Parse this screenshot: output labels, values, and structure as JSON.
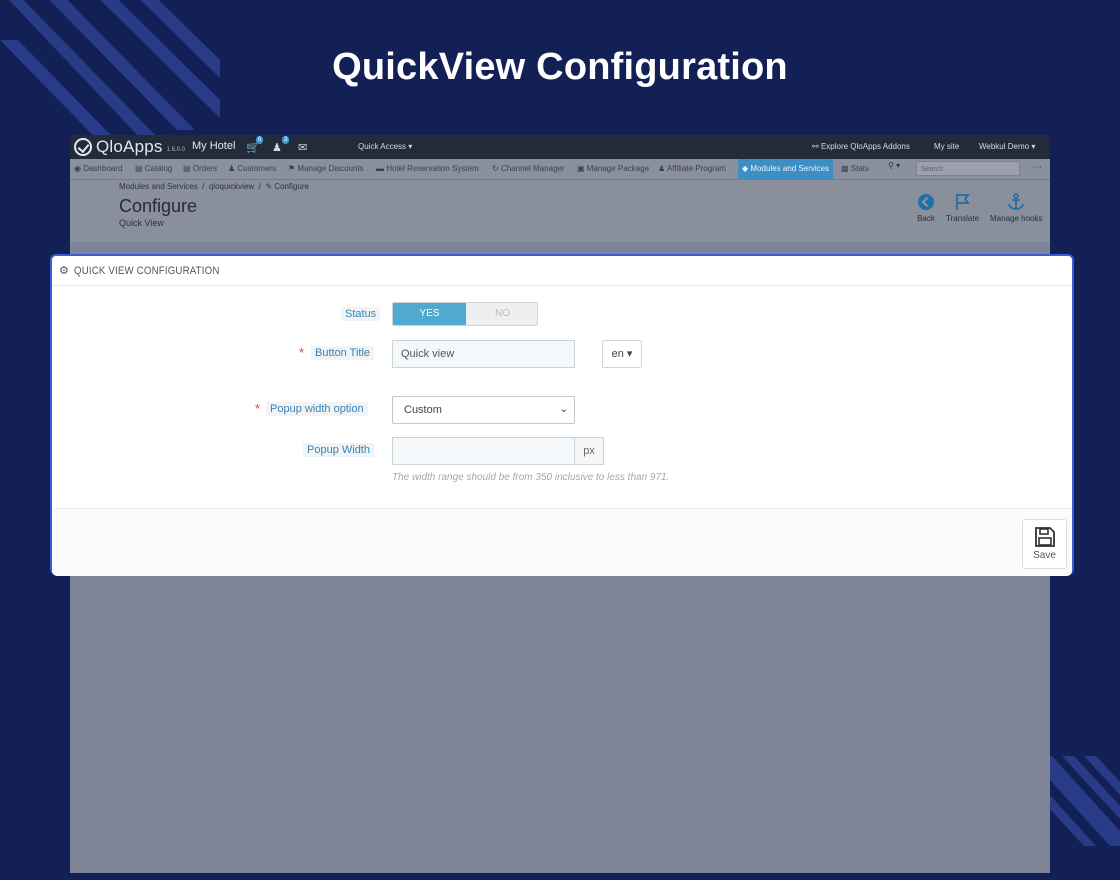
{
  "banner": {
    "title": "QuickView Configuration"
  },
  "topbar": {
    "brand": "QloApps",
    "version": "1.6.0.0",
    "hotel": "My Hotel",
    "cart_badge": "0",
    "customer_badge": "3",
    "quick_access": "Quick Access",
    "explore_addons": "Explore QloApps Addons",
    "my_site": "My site",
    "user": "Webkul Demo"
  },
  "nav": {
    "items": [
      {
        "label": "Dashboard",
        "icon": "dashboard-icon"
      },
      {
        "label": "Catalog",
        "icon": "book-icon"
      },
      {
        "label": "Orders",
        "icon": "credit-card-icon"
      },
      {
        "label": "Customers",
        "icon": "users-icon"
      },
      {
        "label": "Manage Discounts",
        "icon": "tag-icon"
      },
      {
        "label": "Hotel Reservation System",
        "icon": "bed-icon"
      },
      {
        "label": "Channel Manager",
        "icon": "refresh-icon"
      },
      {
        "label": "Manage Package",
        "icon": "briefcase-icon"
      },
      {
        "label": "Affiliate Program",
        "icon": "users-icon"
      },
      {
        "label": "Modules and Services",
        "icon": "puzzle-icon",
        "active": true
      },
      {
        "label": "Stats",
        "icon": "bar-chart-icon"
      }
    ],
    "search_placeholder": "Search"
  },
  "page_head": {
    "breadcrumb": [
      "Modules and Services",
      "qloquickview",
      "Configure"
    ],
    "title": "Configure",
    "subtitle": "Quick View",
    "toolbar": {
      "back": "Back",
      "translate": "Translate",
      "manage_hooks": "Manage hooks"
    }
  },
  "panel": {
    "title": "QUICK VIEW CONFIGURATION",
    "status": {
      "label": "Status",
      "yes": "YES",
      "no": "NO",
      "value": "YES"
    },
    "button_title": {
      "label": "Button Title",
      "value": "Quick view",
      "lang": "en",
      "required": true
    },
    "popup_width_option": {
      "label": "Popup width option",
      "value": "Custom",
      "required": true
    },
    "popup_width": {
      "label": "Popup Width",
      "value": "",
      "suffix": "px",
      "help": "The width range should be from 350 inclusive to less than 971."
    },
    "save": "Save"
  },
  "colors": {
    "background": "#132055",
    "accent": "#4fa9d1",
    "panel_border": "#3b5bd8",
    "required": "#e04a2d"
  }
}
